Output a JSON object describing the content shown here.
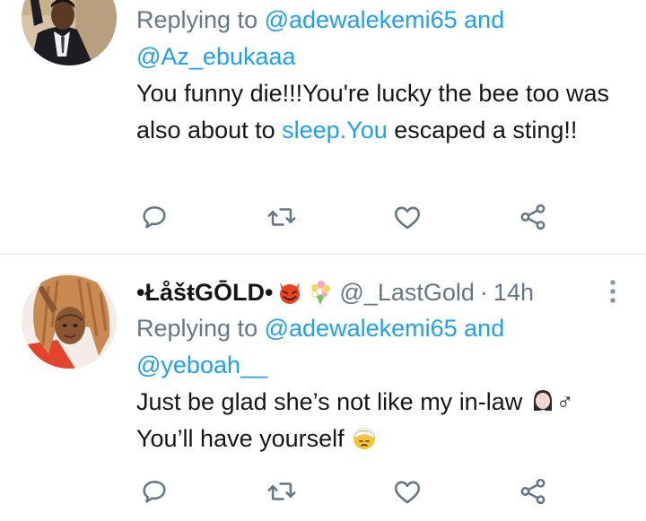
{
  "tweets": [
    {
      "display_name": "",
      "handle": "",
      "time": "",
      "replying_prefix": "Replying to",
      "replying_mention_1": "@adewalekemi65",
      "replying_and": "and",
      "replying_mention_2": "@Az_ebukaaa",
      "text_part_1": "You funny die!!!You're lucky the bee too was also about to ",
      "text_link": "sleep.You",
      "text_part_2": " escaped a sting!!",
      "avatar_icon": "avatar-man-raising-hand"
    },
    {
      "display_name": "•ŁåšŧGŌLD•",
      "handle": "@_LastGold",
      "dot": "·",
      "time": "14h",
      "replying_prefix": "Replying to",
      "replying_mention_1": "@adewalekemi65",
      "replying_and": "and",
      "replying_mention_2": "@yeboah__",
      "text_line_1": "Just be glad she’s not like my in-law",
      "male_sign": "♂",
      "text_line_2": "You’ll have yourself",
      "avatar_icon": "avatar-woman-braids"
    }
  ],
  "icons": {
    "reply": "reply-icon",
    "retweet": "retweet-icon",
    "like": "heart-icon",
    "share": "share-icon",
    "more": "more-vertical-icon",
    "emoji_devil": "smiling-devil-emoji",
    "emoji_bouquet": "bouquet-emoji",
    "emoji_facepalm": "woman-facepalming-emoji",
    "emoji_bandage": "face-with-head-bandage-emoji"
  },
  "colors": {
    "text": "#14171a",
    "secondary": "#657786",
    "accent": "#1da1f2",
    "divider": "#e1e8ed"
  }
}
